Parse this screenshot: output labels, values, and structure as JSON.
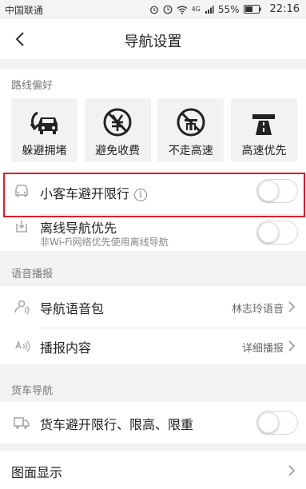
{
  "status_bar": {
    "carrier": "中国联通",
    "network": "4G",
    "battery": "55%",
    "time": "22:16"
  },
  "navbar": {
    "title": "导航设置"
  },
  "route_pref": {
    "label": "路线偏好",
    "tiles": [
      {
        "label": "躲避拥堵",
        "icon": "avoid-congestion-icon"
      },
      {
        "label": "避免收费",
        "icon": "avoid-toll-icon"
      },
      {
        "label": "不走高速",
        "icon": "no-highway-icon"
      },
      {
        "label": "高速优先",
        "icon": "highway-first-icon"
      }
    ]
  },
  "restriction": {
    "label": "小客车避开限行",
    "info_glyph": "i",
    "toggle_on": false,
    "highlight_color": "#e01d25"
  },
  "offline": {
    "label": "离线导航优先",
    "sub": "非Wi-Fi网络优先使用离线导航",
    "toggle_on": false
  },
  "voice": {
    "label": "语音播报",
    "rows": [
      {
        "label": "导航语音包",
        "value": "林志玲语音"
      },
      {
        "label": "播报内容",
        "value": "详细播报"
      }
    ]
  },
  "truck": {
    "label": "货车导航",
    "row": {
      "label": "货车避开限行、限高、限重",
      "toggle_on": false
    }
  },
  "display": {
    "label": "图面显示"
  }
}
